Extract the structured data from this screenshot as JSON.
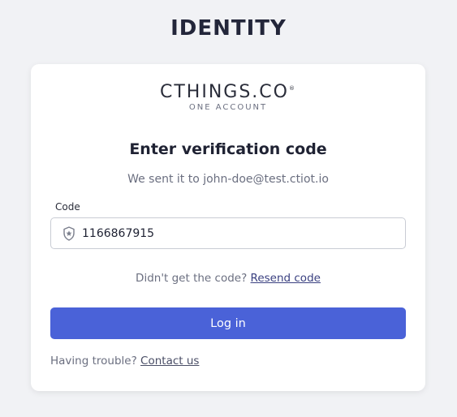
{
  "header": {
    "title": "IDENTITY"
  },
  "logo": {
    "main": "CTHINGS.CO",
    "registered": "®",
    "tagline": "ONE ACCOUNT"
  },
  "form": {
    "heading": "Enter verification code",
    "sent_to_text": "We sent it to john-doe@test.ctiot.io",
    "code_label": "Code",
    "code_value": "1166867915",
    "code_icon": "shield-star-icon",
    "resend_prompt": "Didn't get the code?",
    "resend_link": "Resend code",
    "login_label": "Log in",
    "trouble_prompt": "Having trouble?",
    "contact_link": "Contact us"
  },
  "colors": {
    "background": "#f1f2f5",
    "card": "#ffffff",
    "primary_button": "#4a62d8",
    "text_muted": "#6b6f80"
  }
}
